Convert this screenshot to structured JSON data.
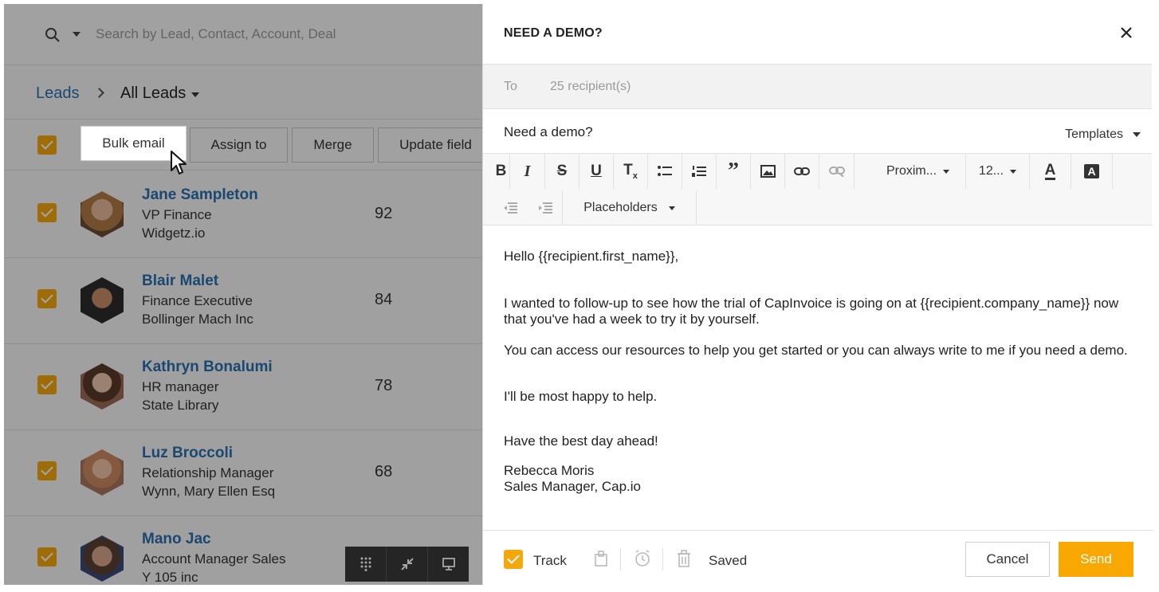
{
  "search": {
    "placeholder": "Search by Lead, Contact, Account, Deal"
  },
  "breadcrumb": {
    "root": "Leads",
    "current": "All Leads"
  },
  "actions": {
    "bulk_email": "Bulk email",
    "assign_to": "Assign to",
    "merge": "Merge",
    "update_field": "Update field"
  },
  "leads": [
    {
      "name": "Jane Sampleton",
      "title": "VP Finance",
      "company": "Widgetz.io",
      "score": "92"
    },
    {
      "name": "Blair Malet",
      "title": "Finance Executive",
      "company": "Bollinger Mach Inc",
      "score": "84"
    },
    {
      "name": "Kathryn Bonalumi",
      "title": "HR manager",
      "company": "State Library",
      "score": "78"
    },
    {
      "name": "Luz Broccoli",
      "title": "Relationship Manager",
      "company": "Wynn, Mary Ellen Esq",
      "score": "68"
    },
    {
      "name": "Mano Jac",
      "title": "Account Manager Sales",
      "company": "Y 105 inc",
      "score": ""
    }
  ],
  "composer": {
    "title": "NEED A DEMO?",
    "to_label": "To",
    "recipients": "25 recipient(s)",
    "subject": "Need a demo?",
    "templates": "Templates",
    "font_family": "Proxim...",
    "font_size": "12...",
    "placeholders": "Placeholders",
    "body": {
      "greeting": "Hello {{recipient.first_name}},",
      "p1_line1": "I wanted to follow-up to see how the trial of CapInvoice is going on at {{recipient.company_name}}  now",
      "p1_line2": "that you've had a week to try it by yourself.",
      "p2": "You can access our resources to help you get started or you can always write to me if you need a demo.",
      "p3": "I'll be most happy to help.",
      "p4": "Have the best day ahead!",
      "sig_name": "Rebecca Moris",
      "sig_title": "Sales Manager, Cap.io"
    },
    "track": "Track",
    "saved": "Saved",
    "cancel": "Cancel",
    "send": "Send"
  },
  "colors": {
    "accent": "#f8a800",
    "link": "#2a6fad",
    "checkbox": "#f5a80d"
  }
}
